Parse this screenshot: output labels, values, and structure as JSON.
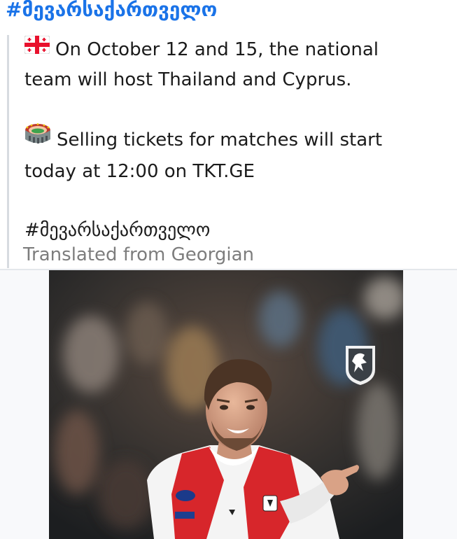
{
  "header": {
    "hashtag": "#მევარსაქართველო"
  },
  "post": {
    "paragraph1_line1": "On October 12 and 15, the national",
    "paragraph1_line2": "team will host Thailand and Cyprus.",
    "paragraph2_line1": "Selling tickets for matches will start",
    "paragraph2_line2": "today at 12:00 on TKT.GE",
    "hashtag": "#მევარსაქართველო",
    "translated_label": "Translated from Georgian",
    "flag_emoji": "georgia-flag-icon",
    "stadium_emoji": "stadium-icon"
  },
  "media": {
    "image": "football-player-celebrating",
    "badge": "georgian-football-federation-crest-icon"
  },
  "colors": {
    "link": "#1a73e8",
    "text": "#1b1b1b",
    "muted": "#7d7d7d",
    "quote_bar": "#d7dbe0"
  }
}
